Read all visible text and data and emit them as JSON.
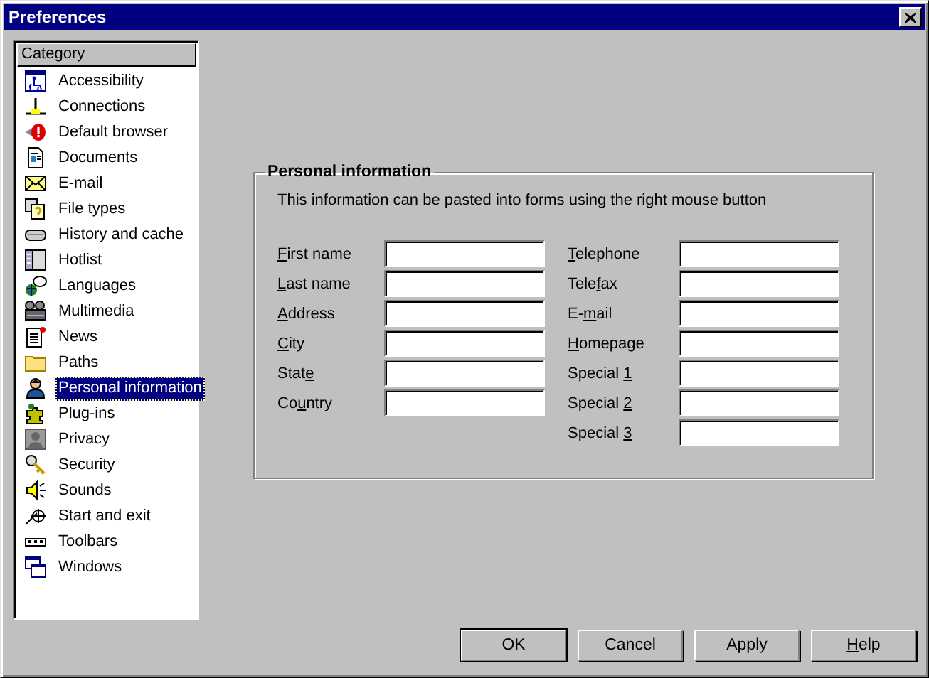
{
  "window": {
    "title": "Preferences"
  },
  "sidebar": {
    "header": "Category",
    "items": [
      {
        "label": "Accessibility",
        "selected": false
      },
      {
        "label": "Connections",
        "selected": false
      },
      {
        "label": "Default browser",
        "selected": false
      },
      {
        "label": "Documents",
        "selected": false
      },
      {
        "label": "E-mail",
        "selected": false
      },
      {
        "label": "File types",
        "selected": false
      },
      {
        "label": "History and cache",
        "selected": false
      },
      {
        "label": "Hotlist",
        "selected": false
      },
      {
        "label": "Languages",
        "selected": false
      },
      {
        "label": "Multimedia",
        "selected": false
      },
      {
        "label": "News",
        "selected": false
      },
      {
        "label": "Paths",
        "selected": false
      },
      {
        "label": "Personal information",
        "selected": true
      },
      {
        "label": "Plug-ins",
        "selected": false
      },
      {
        "label": "Privacy",
        "selected": false
      },
      {
        "label": "Security",
        "selected": false
      },
      {
        "label": "Sounds",
        "selected": false
      },
      {
        "label": "Start and exit",
        "selected": false
      },
      {
        "label": "Toolbars",
        "selected": false
      },
      {
        "label": "Windows",
        "selected": false
      }
    ]
  },
  "group": {
    "title": "Personal information",
    "description": "This information can be pasted into forms using the right mouse button",
    "left_fields": [
      {
        "key": "F",
        "after": "irst name"
      },
      {
        "key": "L",
        "after": "ast name"
      },
      {
        "key": "A",
        "after": "ddress"
      },
      {
        "key": "C",
        "after": "ity"
      },
      {
        "before": "Stat",
        "key": "e"
      },
      {
        "before": "Co",
        "key": "u",
        "after": "ntry"
      }
    ],
    "right_fields": [
      {
        "key": "T",
        "after": "elephone"
      },
      {
        "before": "Tele",
        "key": "f",
        "after": "ax"
      },
      {
        "before": "E-",
        "key": "m",
        "after": "ail"
      },
      {
        "key": "H",
        "after": "omepage"
      },
      {
        "before": "Special ",
        "key": "1"
      },
      {
        "before": "Special ",
        "key": "2"
      },
      {
        "before": "Special ",
        "key": "3"
      }
    ]
  },
  "buttons": [
    {
      "label": "OK",
      "default": true
    },
    {
      "label": "Cancel",
      "default": false
    },
    {
      "label": "Apply",
      "default": false
    },
    {
      "key": "H",
      "after": "elp",
      "default": false
    }
  ]
}
